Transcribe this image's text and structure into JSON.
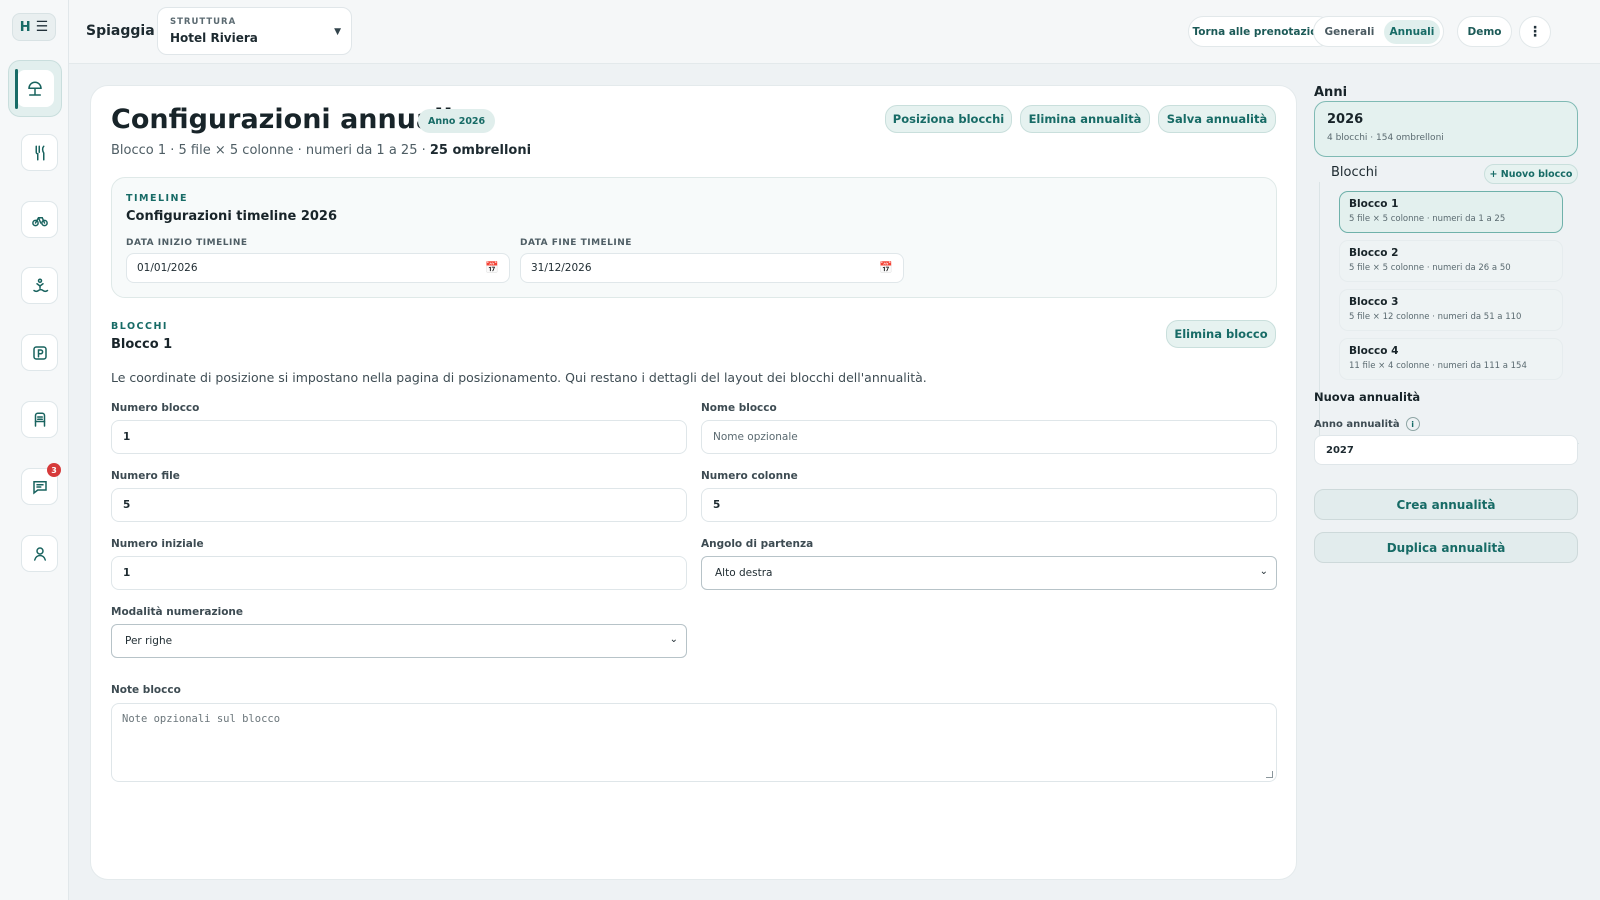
{
  "brand": {
    "logo_letter": "H",
    "menu_glyph": "☰"
  },
  "sidebar": {
    "items": [
      {
        "name": "beach-umbrella",
        "icon": "beach-umbrella-icon",
        "active": true
      },
      {
        "name": "restaurant",
        "icon": "fork-knife-icon"
      },
      {
        "name": "bike",
        "icon": "bicycle-icon"
      },
      {
        "name": "lifeguard",
        "icon": "swimmer-icon"
      },
      {
        "name": "parking",
        "icon": "parking-icon"
      },
      {
        "name": "seat",
        "icon": "chair-icon"
      },
      {
        "name": "messages",
        "icon": "chat-icon",
        "badge": "3"
      },
      {
        "name": "profile",
        "icon": "user-icon"
      }
    ]
  },
  "topbar": {
    "app_name": "Spiaggia",
    "structure_label": "STRUTTURA",
    "structure_value": "Hotel Riviera",
    "back_button": "Torna alle prenotazioni",
    "seg_general": "Generali",
    "seg_annual": "Annuali",
    "demo_button": "Demo",
    "more_glyph": "⋮"
  },
  "main": {
    "title": "Configurazioni annuali",
    "year_badge": "Anno 2026",
    "subtitle_plain": "Blocco 1 · 5 file × 5 colonne · numeri da 1 a 25 · ",
    "subtitle_bold": "25 ombrelloni",
    "actions": {
      "position": "Posiziona blocchi",
      "delete_year": "Elimina annualità",
      "save_year": "Salva annualità"
    },
    "timeline": {
      "eyebrow": "TIMELINE",
      "title": "Configurazioni timeline 2026",
      "start_label": "DATA INIZIO TIMELINE",
      "start_value": "01/01/2026",
      "end_label": "DATA FINE TIMELINE",
      "end_value": "31/12/2026"
    },
    "blocks": {
      "eyebrow": "BLOCCHI",
      "title": "Blocco 1",
      "delete_block": "Elimina blocco",
      "note": "Le coordinate di posizione si impostano nella pagina di posizionamento. Qui restano i dettagli del layout dei blocchi dell'annualità."
    },
    "form": {
      "block_number_label": "Numero blocco",
      "block_number_value": "1",
      "block_name_label": "Nome blocco",
      "block_name_placeholder": "Nome opzionale",
      "rows_label": "Numero file",
      "rows_value": "5",
      "cols_label": "Numero colonne",
      "cols_value": "5",
      "start_num_label": "Numero iniziale",
      "start_num_value": "1",
      "corner_label": "Angolo di partenza",
      "corner_value": "Alto destra",
      "numbering_label": "Modalità numerazione",
      "numbering_value": "Per righe",
      "notes_label": "Note blocco",
      "notes_placeholder": "Note opzionali sul blocco"
    }
  },
  "right": {
    "years_title": "Anni",
    "year": {
      "value": "2026",
      "meta": "4 blocchi · 154 ombrelloni"
    },
    "blocks_title": "Blocchi",
    "new_block": "+ Nuovo blocco",
    "block_items": [
      {
        "name": "Blocco 1",
        "desc": "5 file × 5 colonne · numeri da 1 a 25"
      },
      {
        "name": "Blocco 2",
        "desc": "5 file × 5 colonne · numeri da 26 a 50"
      },
      {
        "name": "Blocco 3",
        "desc": "5 file × 12 colonne · numeri da 51 a 110"
      },
      {
        "name": "Blocco 4",
        "desc": "11 file × 4 colonne · numeri da 111 a 154"
      }
    ],
    "new_year_title": "Nuova annualità",
    "year_input_label": "Anno annualità",
    "info_glyph": "i",
    "year_input_value": "2027",
    "create_button": "Crea annualità",
    "duplicate_button": "Duplica annualità"
  }
}
